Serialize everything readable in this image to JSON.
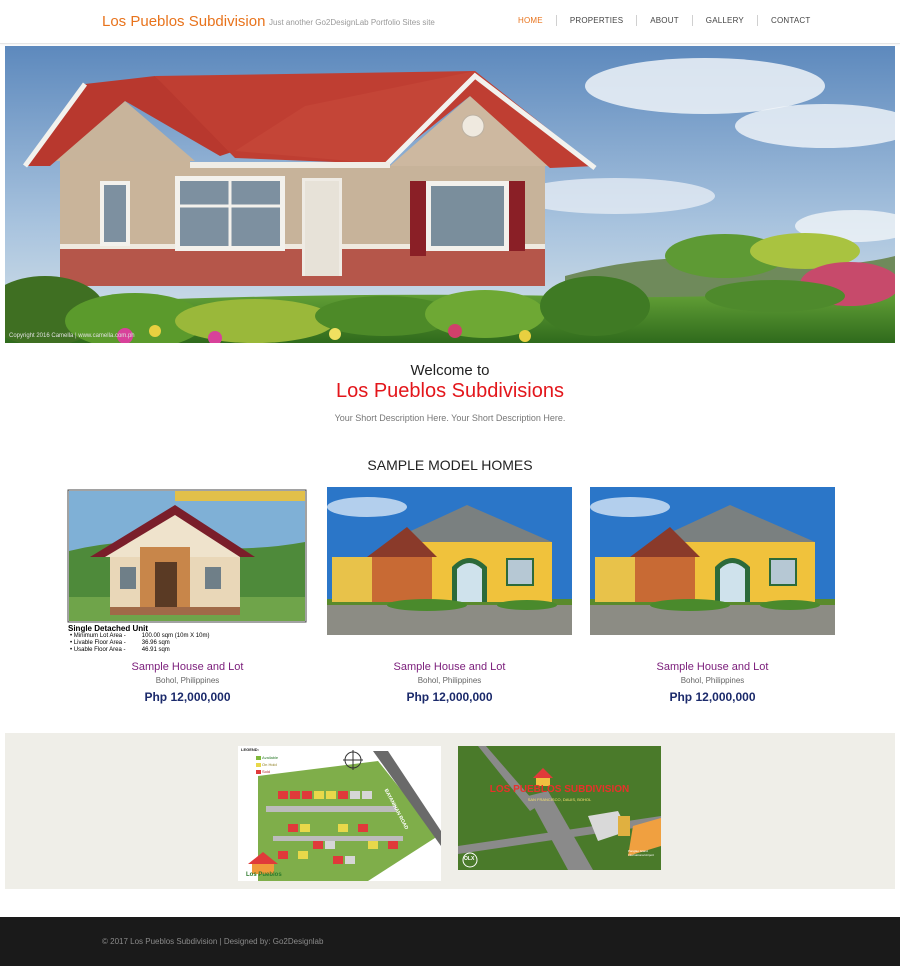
{
  "header": {
    "brand": "Los Pueblos Subdivision",
    "tagline": "Just another Go2DesignLab Portfolio Sites site",
    "nav": [
      "HOME",
      "PROPERTIES",
      "ABOUT",
      "GALLERY",
      "CONTACT"
    ],
    "active_nav": "HOME",
    "accent_color": "#e8731c"
  },
  "hero": {
    "credit": "Copyright 2016 Camella | www.camella.com.ph"
  },
  "welcome": {
    "pre": "Welcome to",
    "title": "Los Pueblos Subdivisions",
    "description": "Your Short Description Here. Your Short Description Here.",
    "title_color": "#e3161b"
  },
  "models": {
    "section_title": "SAMPLE MODEL HOMES",
    "cards": [
      {
        "name": "Sample House and Lot",
        "location": "Bohol, Philippines",
        "price": "Php 12,000,000",
        "image": "brochure",
        "brochure": {
          "heading": "Single Detached Unit",
          "specs": [
            {
              "label": "Minimum Lot Area -",
              "value": "100.00 sqm (10m X 10m)"
            },
            {
              "label": "Livable Floor Area -",
              "value": "36.96 sqm"
            },
            {
              "label": "Usable Floor Area -",
              "value": "46.91 sqm"
            }
          ]
        }
      },
      {
        "name": "Sample House and Lot",
        "location": "Bohol, Philippines",
        "price": "Php 12,000,000",
        "image": "yellow-house-photo"
      },
      {
        "name": "Sample House and Lot",
        "location": "Bohol, Philippines",
        "price": "Php 12,000,000",
        "image": "yellow-house-photo"
      }
    ]
  },
  "maps": {
    "site_plan": {
      "legend_title": "LEGEND:",
      "legend": [
        "Available",
        "On Hold",
        "Sold"
      ],
      "road": "BAYANIHAN ROAD",
      "logo": "Los Pueblos"
    },
    "vicinity": {
      "logo": "LOS PUEBLOS SUBDIVISION",
      "sublogo": "SAN FRANCISCO, DAUIS, BOHOL",
      "airport": "Panglao Island International Airport",
      "badge": "OLX"
    }
  },
  "footer": {
    "text": "© 2017 Los Pueblos Subdivision | Designed by: Go2Designlab"
  }
}
